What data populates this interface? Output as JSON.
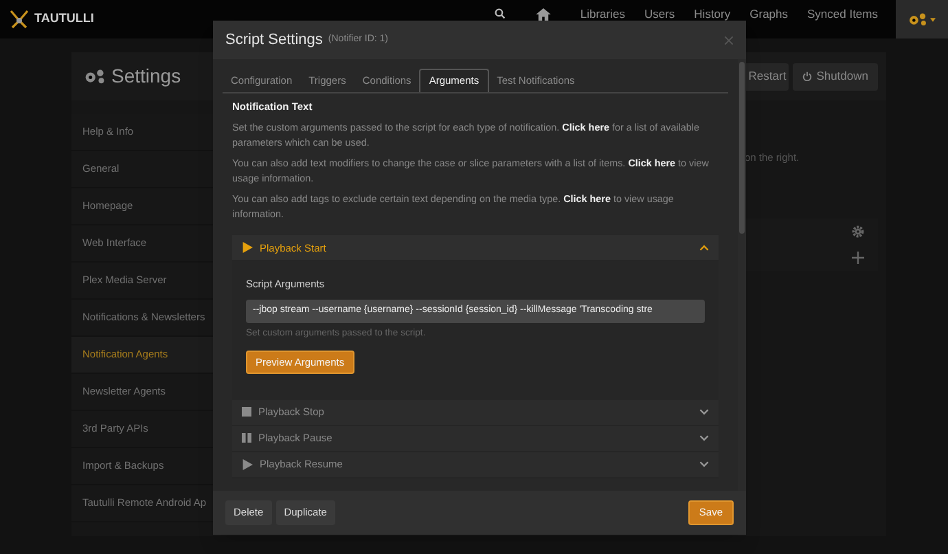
{
  "navbar": {
    "brand": "TAUTULLI",
    "links": [
      {
        "label": "Libraries"
      },
      {
        "label": "Users"
      },
      {
        "label": "History"
      },
      {
        "label": "Graphs"
      },
      {
        "label": "Synced Items"
      }
    ]
  },
  "settings": {
    "title": "Settings",
    "buttons": [
      "Restart",
      "Shutdown"
    ],
    "sidebar": [
      {
        "label": "Help & Info",
        "selected": false
      },
      {
        "label": "General",
        "selected": false
      },
      {
        "label": "Homepage",
        "selected": false
      },
      {
        "label": "Web Interface",
        "selected": false
      },
      {
        "label": "Plex Media Server",
        "selected": false
      },
      {
        "label": "Notifications & Newsletters",
        "selected": false
      },
      {
        "label": "Notification Agents",
        "selected": true
      },
      {
        "label": "Newsletter Agents",
        "selected": false
      },
      {
        "label": "3rd Party APIs",
        "selected": false
      },
      {
        "label": "Import & Backups",
        "selected": false
      },
      {
        "label": "Tautulli Remote Android Ap",
        "selected": false
      }
    ],
    "partial_text": "on the right."
  },
  "modal": {
    "title": "Script Settings",
    "subtitle": "(Notifier ID: 1)",
    "tabs": [
      {
        "label": "Configuration",
        "selected": false
      },
      {
        "label": "Triggers",
        "selected": false
      },
      {
        "label": "Conditions",
        "selected": false
      },
      {
        "label": "Arguments",
        "selected": true
      },
      {
        "label": "Test Notifications",
        "selected": false
      }
    ],
    "section_title": "Notification Text",
    "paragraphs": [
      {
        "before": "Set the custom arguments passed to the script for each type of notification.",
        "link": "Click here",
        "after": "for a list of available parameters which can be used."
      },
      {
        "before": "You can also add text modifiers to change the case or slice parameters with a list of items.",
        "link": "Click here",
        "after": "to view usage information."
      },
      {
        "before": "You can also add tags to exclude certain text depending on the media type.",
        "link": "Click here",
        "after": "to view usage information."
      }
    ],
    "accordion": [
      {
        "label": "Playback Start",
        "kind": "play",
        "expanded": true,
        "field_label": "Script Arguments",
        "value": "--jbop stream --username {username} --sessionId {session_id} --killMessage 'Transcoding stre",
        "help": "Set custom arguments passed to the script.",
        "button": "Preview Arguments"
      },
      {
        "label": "Playback Stop",
        "kind": "stop",
        "expanded": false
      },
      {
        "label": "Playback Pause",
        "kind": "pause",
        "expanded": false
      },
      {
        "label": "Playback Resume",
        "kind": "play",
        "expanded": false
      }
    ],
    "footer": {
      "left_buttons": [
        "Delete",
        "Duplicate"
      ],
      "save": "Save"
    }
  }
}
